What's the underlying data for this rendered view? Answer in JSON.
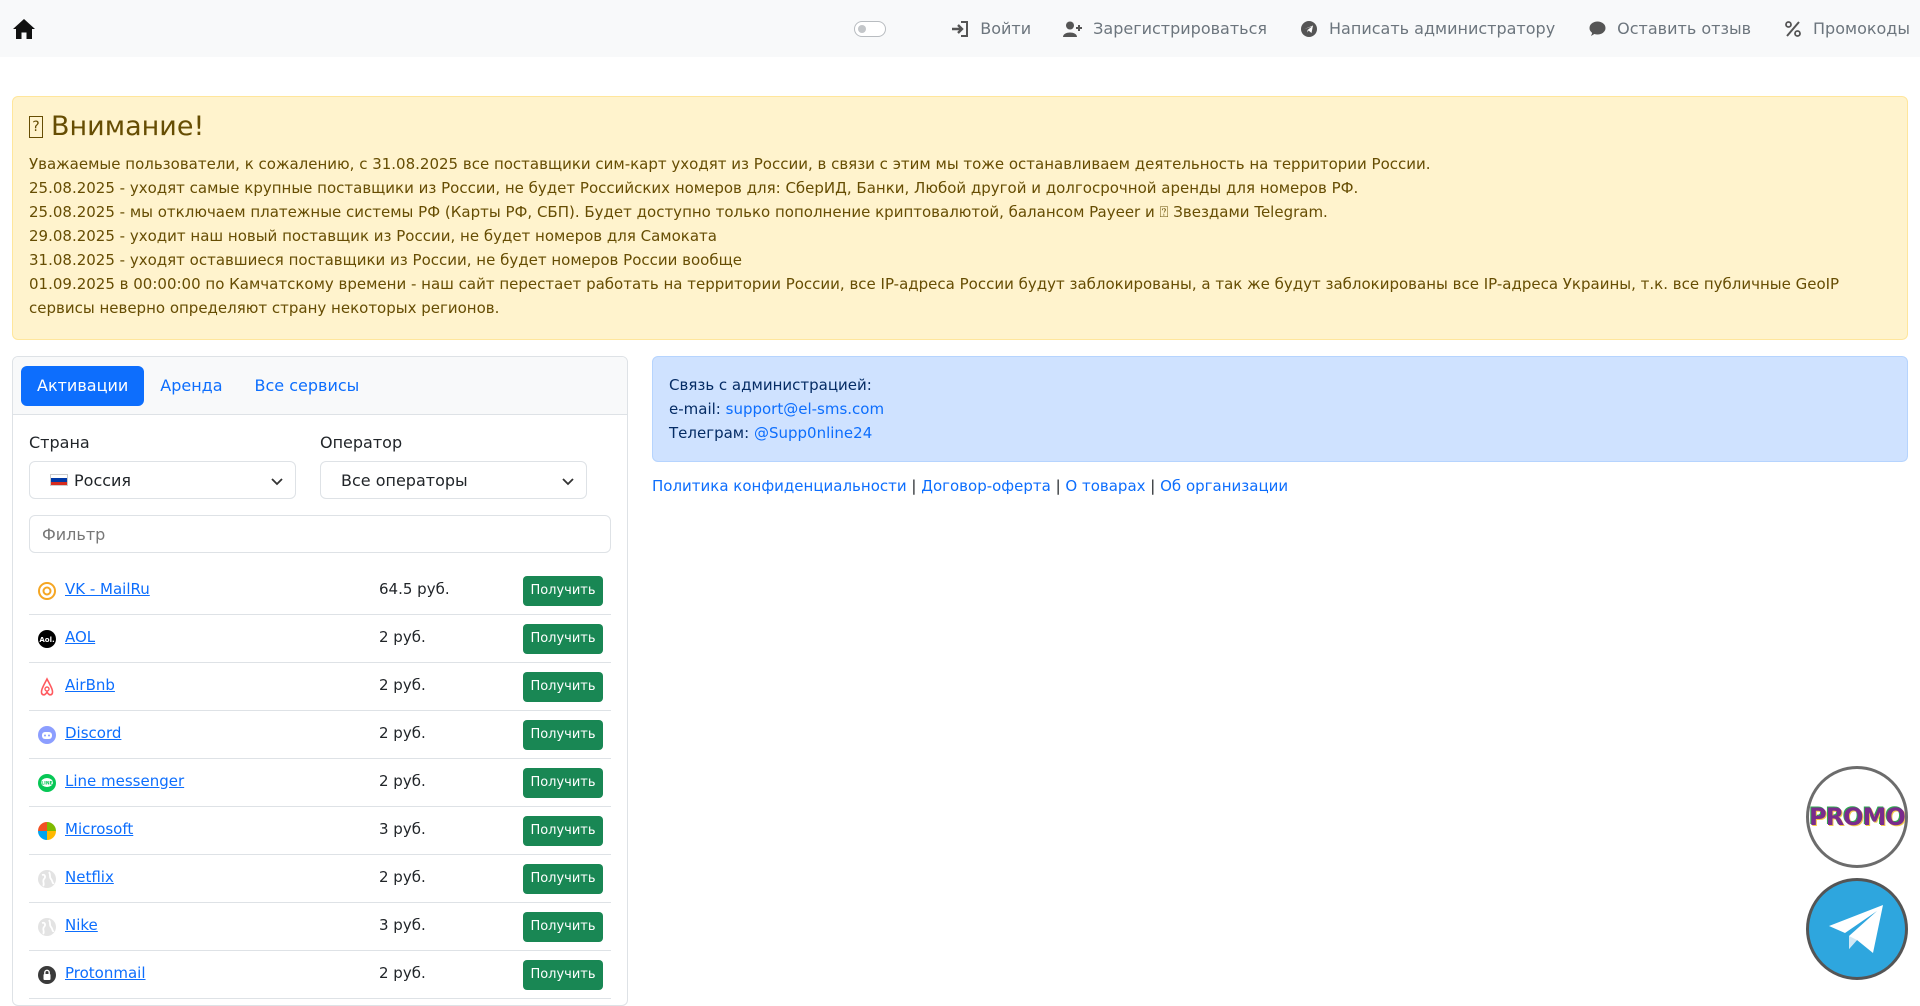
{
  "nav": {
    "login": "Войти",
    "register": "Зарегистрироваться",
    "write_admin": "Написать администратору",
    "feedback": "Оставить отзыв",
    "promocodes": "Промокоды"
  },
  "alert": {
    "title": "Внимание!",
    "lines": [
      "Уважаемые пользователи, к сожалению, с 31.08.2025 все поставщики сим-карт уходят из России, в связи с этим мы тоже останавливаем деятельность на территории России.",
      "25.08.2025 - уходят самые крупные поставщики из России, не будет Российских номеров для: СберИД, Банки, Любой другой и долгосрочной аренды для номеров РФ.",
      "25.08.2025 - мы отключаем платежные системы РФ (Карты РФ, СБП). Будет доступно только пополнение криптовалютой, балансом Payeer и ⍰ Звездами Telegram.",
      "29.08.2025 - уходит наш новый поставщик из России, не будет номеров для Самоката",
      "31.08.2025 - уходят оставшиеся поставщики из России, не будет номеров России вообще",
      "01.09.2025 в 00:00:00 по Камчатскому времени - наш сайт перестает работать на территории России, все IP-адреса России будут заблокированы, а так же будут заблокированы все IP-адреса Украины, т.к. все публичные GeoIP сервисы неверно определяют страну некоторых регионов."
    ]
  },
  "tabs": [
    "Активации",
    "Аренда",
    "Все сервисы"
  ],
  "form": {
    "country_label": "Страна",
    "operator_label": "Оператор",
    "country_value": "Россия",
    "operator_value": "Все операторы",
    "filter_placeholder": "Фильтр"
  },
  "services": [
    {
      "name": "VK - MailRu",
      "price": "64.5 руб.",
      "icon": "mailru-icon",
      "color": "#f5a623"
    },
    {
      "name": "AOL",
      "price": "2 руб.",
      "icon": "aol-icon",
      "color": "#000000"
    },
    {
      "name": "AirBnb",
      "price": "2 руб.",
      "icon": "airbnb-icon",
      "color": "#ff5a5f"
    },
    {
      "name": "Discord",
      "price": "2 руб.",
      "icon": "discord-icon",
      "color": "#8c9eff"
    },
    {
      "name": "Line messenger",
      "price": "2 руб.",
      "icon": "line-icon",
      "color": "#06c755"
    },
    {
      "name": "Microsoft",
      "price": "3 руб.",
      "icon": "microsoft-icon",
      "color": "#f25022"
    },
    {
      "name": "Netflix",
      "price": "2 руб.",
      "icon": "globe-icon",
      "color": "#cccccc"
    },
    {
      "name": "Nike",
      "price": "3 руб.",
      "icon": "globe-icon",
      "color": "#cccccc"
    },
    {
      "name": "Protonmail",
      "price": "2 руб.",
      "icon": "protonmail-icon",
      "color": "#333333"
    }
  ],
  "get_label": "Получить",
  "contact": {
    "title": "Связь с администрацией:",
    "email_label": "e-mail:",
    "email": "support@el-sms.com",
    "telegram_label": "Телеграм:",
    "telegram": "@Supp0nline24"
  },
  "footer_links": [
    "Политика конфиденциальности",
    "Договор-оферта",
    "О товарах",
    "Об организации"
  ],
  "promo_label": "PROMO",
  "colors": {
    "primary": "#0d6efd",
    "success": "#198754",
    "warning_bg": "#fff3cd",
    "info_bg": "#cfe2ff"
  }
}
